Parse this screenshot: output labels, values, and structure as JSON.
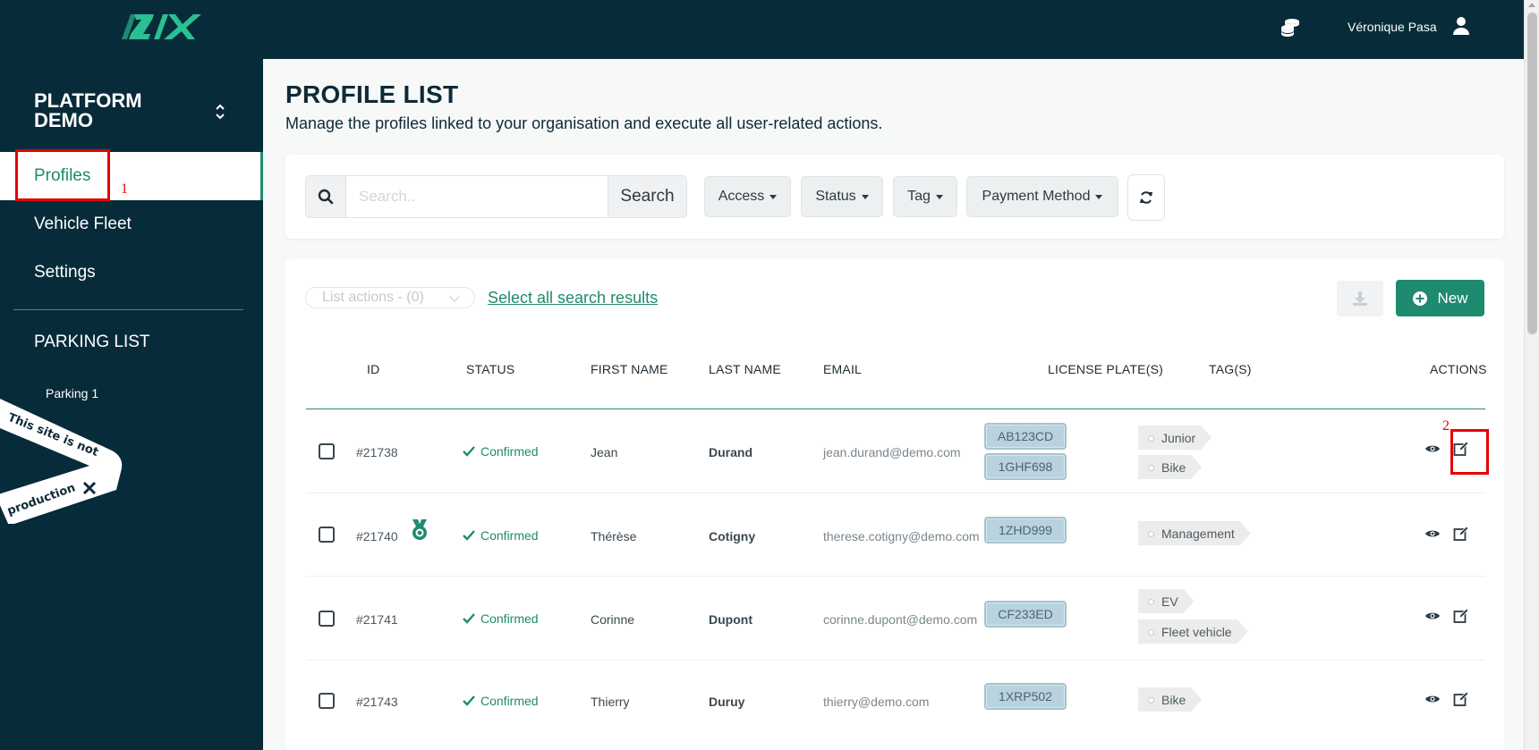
{
  "header": {
    "user_name": "Véronique Pasa",
    "icons": [
      "izix-logo",
      "coins-icon",
      "user-icon"
    ]
  },
  "sidebar": {
    "org_name": "PLATFORM DEMO",
    "items": [
      {
        "label": "Profiles",
        "active": true
      },
      {
        "label": "Vehicle Fleet",
        "active": false
      },
      {
        "label": "Settings",
        "active": false
      }
    ],
    "section_title": "PARKING LIST",
    "parkings": [
      "Parking 1"
    ],
    "ribbon_line1": "This site is not",
    "ribbon_line2": "production"
  },
  "annotations": {
    "box1": "1",
    "box2": "2"
  },
  "page": {
    "title": "PROFILE LIST",
    "subtitle": "Manage the profiles linked to your organisation and execute all user-related actions."
  },
  "filters": {
    "search_placeholder": "Search..",
    "search_button": "Search",
    "access": "Access",
    "status": "Status",
    "tag": "Tag",
    "payment_method": "Payment Method"
  },
  "list": {
    "list_actions": "List actions - (0)",
    "select_all": "Select all search results",
    "new_button": "New",
    "columns": {
      "id": "ID",
      "status": "STATUS",
      "first_name": "FIRST NAME",
      "last_name": "LAST NAME",
      "email": "EMAIL",
      "plates": "LICENSE PLATE(S)",
      "tags": "TAG(S)",
      "actions": "ACTIONS"
    },
    "rows": [
      {
        "id": "#21738",
        "status": "Confirmed",
        "first_name": "Jean",
        "last_name": "Durand",
        "email": "jean.durand@demo.com",
        "plates": [
          "AB123CD",
          "1GHF698"
        ],
        "tags": [
          "Junior",
          "Bike"
        ],
        "medal": false
      },
      {
        "id": "#21740",
        "status": "Confirmed",
        "first_name": "Thérèse",
        "last_name": "Cotigny",
        "email": "therese.cotigny@demo.com",
        "plates": [
          "1ZHD999"
        ],
        "tags": [
          "Management"
        ],
        "medal": true
      },
      {
        "id": "#21741",
        "status": "Confirmed",
        "first_name": "Corinne",
        "last_name": "Dupont",
        "email": "corinne.dupont@demo.com",
        "plates": [
          "CF233ED"
        ],
        "tags": [
          "EV",
          "Fleet vehicle"
        ],
        "medal": false
      },
      {
        "id": "#21743",
        "status": "Confirmed",
        "first_name": "Thierry",
        "last_name": "Duruy",
        "email": "thierry@demo.com",
        "plates": [
          "1XRP502"
        ],
        "tags": [
          "Bike"
        ],
        "medal": false
      }
    ]
  },
  "colors": {
    "navy": "#082b3a",
    "accent": "#1e8a6f",
    "annotation": "#e60000"
  }
}
